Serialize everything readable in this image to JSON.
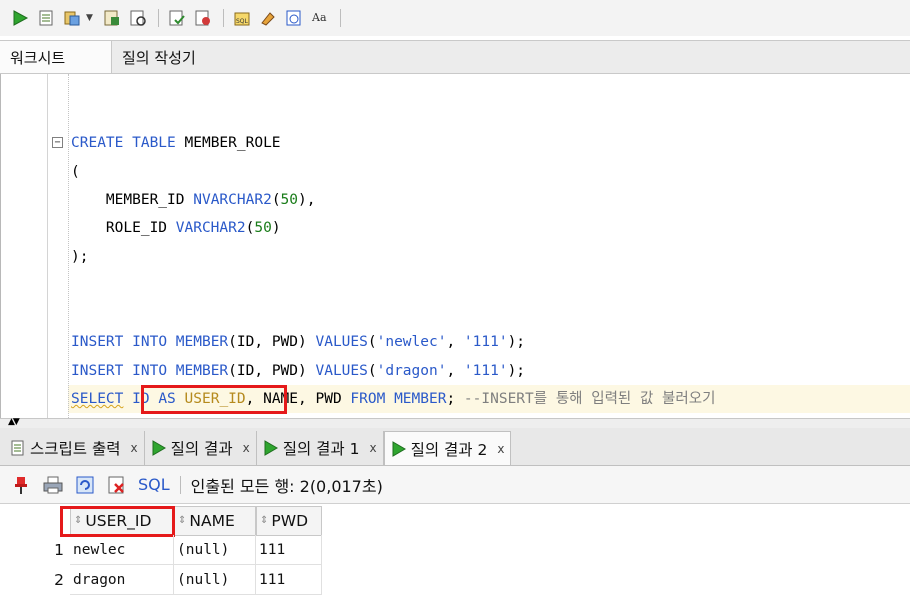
{
  "toolbar": {
    "icons": [
      "run-statement-icon",
      "run-script-icon",
      "commit-icon",
      "dropdown-arrow-icon",
      "explain-plan-icon",
      "autotrace-icon",
      "commit-transaction-icon",
      "rollback-icon",
      "sql-tuning-icon",
      "clear-icon",
      "history-icon",
      "format-case-icon"
    ]
  },
  "editor_tabs": [
    {
      "label": "워크시트",
      "active": true
    },
    {
      "label": "질의 작성기",
      "active": false
    }
  ],
  "code": {
    "create_kw": "CREATE TABLE",
    "create_name": "MEMBER_ROLE",
    "open_paren": "(",
    "col1_name": "MEMBER_ID",
    "col1_type": "NVARCHAR2",
    "col1_len": "50",
    "col2_name": "ROLE_ID",
    "col2_type": "VARCHAR2",
    "col2_len": "50",
    "close_paren": ");",
    "insert1": {
      "kw1": "INSERT",
      "kw2": "INTO",
      "table": "MEMBER",
      "cols": "(ID, PWD)",
      "kw3": "VALUES",
      "v1": "'newlec'",
      "v2": "'111'"
    },
    "insert2": {
      "kw1": "INSERT",
      "kw2": "INTO",
      "table": "MEMBER",
      "cols": "(ID, PWD)",
      "kw3": "VALUES",
      "v1": "'dragon'",
      "v2": "'111'"
    },
    "select": {
      "kw": "SELECT",
      "col": "ID",
      "as": "AS",
      "alias": "USER_ID",
      "rest": ", NAME, PWD",
      "from": "FROM",
      "table": "MEMBER",
      "semi": ";",
      "comment": "--INSERT를 통해 입력된 값 불러오기"
    }
  },
  "output_tabs": [
    {
      "label": "스크립트 출력",
      "icon": "script-output-icon",
      "active": false
    },
    {
      "label": "질의 결과",
      "icon": "query-result-icon",
      "active": false
    },
    {
      "label": "질의 결과 1",
      "icon": "query-result-icon",
      "active": false
    },
    {
      "label": "질의 결과 2",
      "icon": "query-result-icon",
      "active": true
    }
  ],
  "close_glyph": "x",
  "result_bar": {
    "sql_label": "SQL",
    "status": "인출된 모든 행: 2(0,017초)"
  },
  "grid": {
    "columns": [
      "USER_ID",
      "NAME",
      "PWD"
    ],
    "rows": [
      {
        "num": "1",
        "cells": [
          "newlec",
          "(null)",
          "111"
        ]
      },
      {
        "num": "2",
        "cells": [
          "dragon",
          "(null)",
          "111"
        ]
      }
    ]
  },
  "colors": {
    "keyword": "#2a59c9",
    "number": "#197c19",
    "comment": "#7f7f7f",
    "highlight_box": "#e5191a",
    "current_line": "#fdf8e3"
  }
}
